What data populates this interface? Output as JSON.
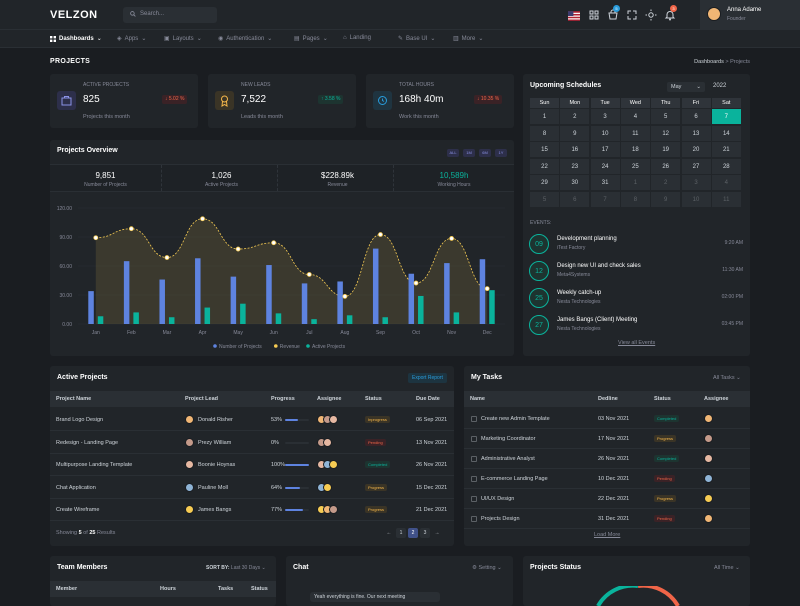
{
  "app": {
    "logo": "VELZON",
    "search_placeholder": "Search..."
  },
  "user": {
    "name": "Anna Adame",
    "role": "Founder"
  },
  "topbar": {
    "cart_badge": "5",
    "bell_badge": "3"
  },
  "nav": [
    {
      "label": "Dashboards"
    },
    {
      "label": "Apps"
    },
    {
      "label": "Layouts"
    },
    {
      "label": "Authentication"
    },
    {
      "label": "Pages"
    },
    {
      "label": "Landing"
    },
    {
      "label": "Base UI"
    },
    {
      "label": "More"
    }
  ],
  "page": {
    "title": "PROJECTS",
    "breadcrumb_root": "Dashboards",
    "breadcrumb_sep": ">",
    "breadcrumb_current": "Projects"
  },
  "stats": [
    {
      "label": "ACTIVE PROJECTS",
      "value": "825",
      "change": "5.02 %",
      "trend": "down",
      "sub": "Projects this month"
    },
    {
      "label": "NEW LEADS",
      "value": "7,522",
      "change": "3.58 %",
      "trend": "up",
      "sub": "Leads this month"
    },
    {
      "label": "TOTAL HOURS",
      "value": "168h 40m",
      "change": "10.35 %",
      "trend": "down",
      "sub": "Work this month"
    }
  ],
  "overview": {
    "title": "Projects Overview",
    "filters": [
      "ALL",
      "1M",
      "6M",
      "1Y"
    ],
    "kpis": [
      {
        "value": "9,851",
        "label": "Number of Projects"
      },
      {
        "value": "1,026",
        "label": "Active Projects"
      },
      {
        "value": "$228.89k",
        "label": "Revenue"
      },
      {
        "value": "10,589h",
        "label": "Working Hours"
      }
    ]
  },
  "chart_data": {
    "type": "bar",
    "categories": [
      "Jan",
      "Feb",
      "Mar",
      "Apr",
      "May",
      "Jun",
      "Jul",
      "Aug",
      "Sep",
      "Oct",
      "Nov",
      "Dec"
    ],
    "series": [
      {
        "name": "Number of Projects",
        "type": "bar",
        "color": "#5e83e0",
        "values": [
          34,
          65,
          46,
          68,
          49,
          61,
          42,
          44,
          78,
          52,
          63,
          67
        ]
      },
      {
        "name": "Revenue",
        "type": "area",
        "color": "#f7cc53",
        "values": [
          89.25,
          98.58,
          68.74,
          108.87,
          77.54,
          84.03,
          51.24,
          28.57,
          92.57,
          42.36,
          88.51,
          36.57
        ]
      },
      {
        "name": "Active Projects",
        "type": "bar",
        "color": "#0ab39c",
        "values": [
          8,
          12,
          7,
          17,
          21,
          11,
          5,
          9,
          7,
          29,
          12,
          35
        ]
      }
    ],
    "ylim": [
      0,
      120
    ],
    "yticks": [
      "0.00",
      "30.00",
      "60.00",
      "90.00",
      "120.00"
    ],
    "grid": true,
    "legend": "bottom"
  },
  "calendar": {
    "title": "Upcoming Schedules",
    "month": "May",
    "year": "2022",
    "weekdays": [
      "Sun",
      "Mon",
      "Tue",
      "Wed",
      "Thu",
      "Fri",
      "Sat"
    ],
    "weeks": [
      [
        {
          "d": "1"
        },
        {
          "d": "2"
        },
        {
          "d": "3"
        },
        {
          "d": "4"
        },
        {
          "d": "5"
        },
        {
          "d": "6"
        },
        {
          "d": "7",
          "sel": true
        }
      ],
      [
        {
          "d": "8"
        },
        {
          "d": "9"
        },
        {
          "d": "10"
        },
        {
          "d": "11"
        },
        {
          "d": "12"
        },
        {
          "d": "13"
        },
        {
          "d": "14"
        }
      ],
      [
        {
          "d": "15"
        },
        {
          "d": "16"
        },
        {
          "d": "17"
        },
        {
          "d": "18"
        },
        {
          "d": "19"
        },
        {
          "d": "20"
        },
        {
          "d": "21"
        }
      ],
      [
        {
          "d": "22"
        },
        {
          "d": "23"
        },
        {
          "d": "24"
        },
        {
          "d": "25"
        },
        {
          "d": "26"
        },
        {
          "d": "27"
        },
        {
          "d": "28"
        }
      ],
      [
        {
          "d": "29"
        },
        {
          "d": "30"
        },
        {
          "d": "31"
        },
        {
          "d": "1",
          "dim": true
        },
        {
          "d": "2",
          "dim": true
        },
        {
          "d": "3",
          "dim": true
        },
        {
          "d": "4",
          "dim": true
        }
      ],
      [
        {
          "d": "5",
          "dim": true
        },
        {
          "d": "6",
          "dim": true
        },
        {
          "d": "7",
          "dim": true
        },
        {
          "d": "8",
          "dim": true
        },
        {
          "d": "9",
          "dim": true
        },
        {
          "d": "10",
          "dim": true
        },
        {
          "d": "11",
          "dim": true
        }
      ]
    ],
    "events_label": "EVENTS:",
    "events": [
      {
        "day": "09",
        "title": "Development planning",
        "sub": "iTest Factory",
        "time": "9:20 AM"
      },
      {
        "day": "12",
        "title": "Design new UI and check sales",
        "sub": "Meta4Systems",
        "time": "11:30 AM"
      },
      {
        "day": "25",
        "title": "Weekly catch-up",
        "sub": "Nesta Technologies",
        "time": "02:00 PM"
      },
      {
        "day": "27",
        "title": "James Bangs (Client) Meeting",
        "sub": "Nesta Technologies",
        "time": "03:45 PM"
      }
    ],
    "view_all": "View all Events"
  },
  "active_projects": {
    "title": "Active Projects",
    "export": "Export Report",
    "columns": [
      "Project Name",
      "Project Lead",
      "Progress",
      "Assignee",
      "Status",
      "Due Date"
    ],
    "rows": [
      {
        "name": "Brand Logo Design",
        "lead": "Donald Risher",
        "progress": "53%",
        "pct": 53,
        "status": "Inprogress",
        "st": "progress",
        "due": "06 Sep 2021"
      },
      {
        "name": "Redesign - Landing Page",
        "lead": "Prezy William",
        "progress": "0%",
        "pct": 0,
        "status": "Pending",
        "st": "pending",
        "due": "13 Nov 2021"
      },
      {
        "name": "Multipurpose Landing Template",
        "lead": "Boonie Hoynas",
        "progress": "100%",
        "pct": 100,
        "status": "Completed",
        "st": "completed",
        "due": "26 Nov 2021"
      },
      {
        "name": "Chat Application",
        "lead": "Pauline Moll",
        "progress": "64%",
        "pct": 64,
        "status": "Progress",
        "st": "progress",
        "due": "15 Dec 2021"
      },
      {
        "name": "Create Wireframe",
        "lead": "James Bangs",
        "progress": "77%",
        "pct": 77,
        "status": "Progress",
        "st": "progress",
        "due": "21 Dec 2021"
      }
    ],
    "footer_showing": "Showing",
    "footer_count": "5",
    "footer_of": "of",
    "footer_total": "25",
    "footer_results": "Results",
    "pages": [
      "←",
      "1",
      "2",
      "3",
      "→"
    ]
  },
  "tasks": {
    "title": "My Tasks",
    "filter": "All Tasks",
    "columns": [
      "Name",
      "Dedline",
      "Status",
      "Assignee"
    ],
    "rows": [
      {
        "name": "Create new Admin Template",
        "date": "03 Nov 2021",
        "status": "Completed",
        "st": "completed"
      },
      {
        "name": "Marketing Coordinator",
        "date": "17 Nov 2021",
        "status": "Progress",
        "st": "progress"
      },
      {
        "name": "Administrative Analyst",
        "date": "26 Nov 2021",
        "status": "Completed",
        "st": "completed"
      },
      {
        "name": "E-commerce Landing Page",
        "date": "10 Dec 2021",
        "status": "Pending",
        "st": "pending"
      },
      {
        "name": "UI/UX Design",
        "date": "22 Dec 2021",
        "status": "Progress",
        "st": "progress"
      },
      {
        "name": "Projects Design",
        "date": "31 Dec 2021",
        "status": "Pending",
        "st": "pending"
      }
    ],
    "load_more": "Load More"
  },
  "team": {
    "title": "Team Members",
    "sort_label": "SORT BY:",
    "sort_value": "Last 30 Days",
    "columns": [
      "Member",
      "Hours",
      "Tasks",
      "Status"
    ]
  },
  "chat": {
    "title": "Chat",
    "setting": "Setting",
    "preview": "Yeah everything is fine. Our next meeting"
  },
  "projects_status": {
    "title": "Projects Status",
    "filter": "All Time"
  }
}
